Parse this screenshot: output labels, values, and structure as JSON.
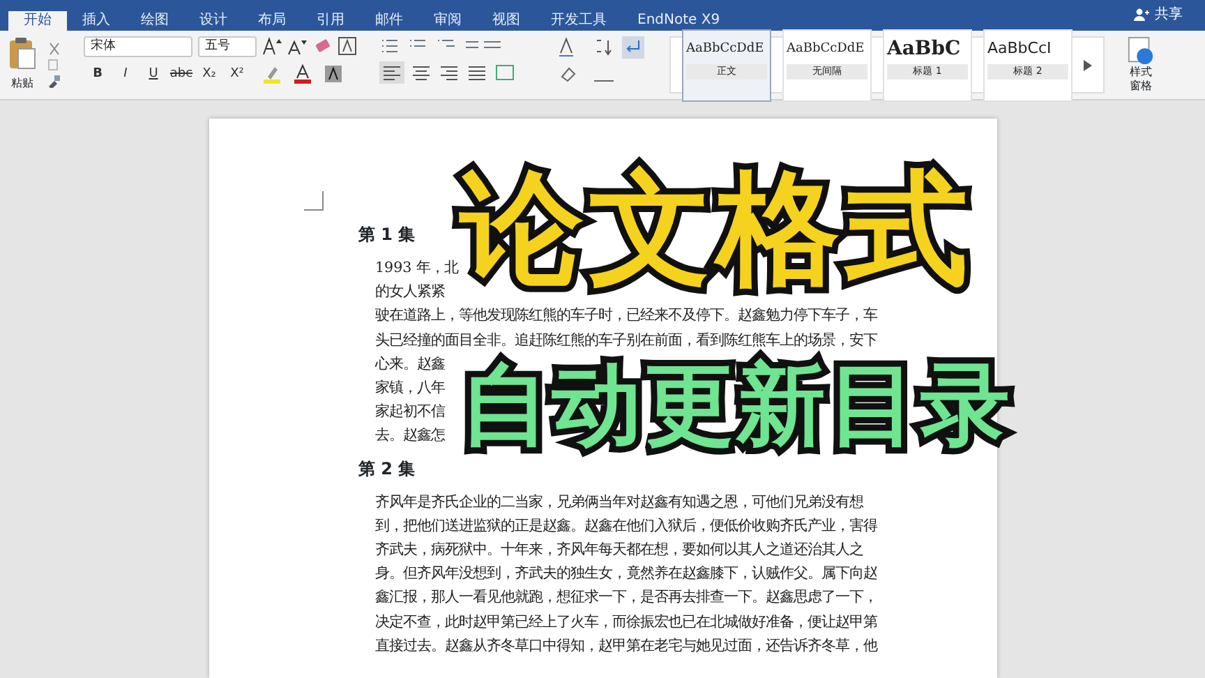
{
  "tabs": [
    {
      "label": "开始",
      "selected": true
    },
    {
      "label": "插入",
      "selected": false
    },
    {
      "label": "绘图",
      "selected": false
    },
    {
      "label": "设计",
      "selected": false
    },
    {
      "label": "布局",
      "selected": false
    },
    {
      "label": "引用",
      "selected": false
    },
    {
      "label": "邮件",
      "selected": false
    },
    {
      "label": "审阅",
      "selected": false
    },
    {
      "label": "视图",
      "selected": false
    },
    {
      "label": "开发工具",
      "selected": false
    },
    {
      "label": "EndNote X9",
      "selected": false
    }
  ],
  "share": "共享",
  "ribbon": {
    "paste": "粘贴",
    "font": "宋体",
    "size": "五号",
    "format_buttons": [
      "B",
      "I",
      "U",
      "abc",
      "X₂",
      "X²"
    ],
    "styles": [
      {
        "preview": "AaBbCcDdE",
        "name": "正文",
        "kind": "body",
        "selected": true
      },
      {
        "preview": "AaBbCcDdE",
        "name": "无间隔",
        "kind": "body",
        "selected": false
      },
      {
        "preview": "AaBbC",
        "name": "标题 1",
        "kind": "heading1",
        "selected": false
      },
      {
        "preview": "AaBbCcI",
        "name": "标题 2",
        "kind": "heading2",
        "selected": false
      }
    ],
    "styles_pane": [
      "样式",
      "窗格"
    ]
  },
  "overlay": {
    "title": "论文格式",
    "subtitle": "自动更新目录"
  },
  "document": [
    {
      "heading": "第 1 集",
      "lines": [
        [
          "1993 年，北"
        ],
        [
          "的女人紧紧"
        ],
        [
          "驶在道路上，等他发现陈红熊的车子时，已经来不及停下。赵鑫勉力停下车子，车"
        ],
        [
          "头已经撞的面目全非。追赶陈红熊的车子别在前面，看到陈红熊车上的场景，安下"
        ],
        [
          "心来。赵鑫"
        ],
        [
          "家镇，八年"
        ],
        [
          "家起初不信"
        ],
        [
          "去。赵鑫怎"
        ]
      ]
    },
    {
      "heading": "第 2 集",
      "lines": [
        [
          "齐风年是齐氏企业的二当家，兄弟俩当年对赵鑫有知遇之恩，可他们兄弟没有想"
        ],
        [
          "到，把他们送进监狱的正是赵鑫。赵鑫在他们入狱后，便低价收购齐氏产业，害得"
        ],
        [
          "齐武夫，病死狱中。十年来，齐风年每天都在想，要如何以其人之道还治其人之"
        ],
        [
          "身。但齐风年没想到，齐武夫的独生女，竟然养在赵鑫膝下，认贼作父。属下向赵"
        ],
        [
          "鑫汇报，那人一看见他就跑，想征求一下，是否再去排查一下。赵鑫思虑了一下，"
        ],
        [
          "决定不查，此时赵甲第已经上了火车，而徐振宏也已在北城做好准备，便让赵甲第"
        ],
        [
          "直接过去。赵鑫从齐冬草口中得知，赵甲第在老宅与她见过面，还告诉齐冬草，他"
        ]
      ]
    }
  ]
}
